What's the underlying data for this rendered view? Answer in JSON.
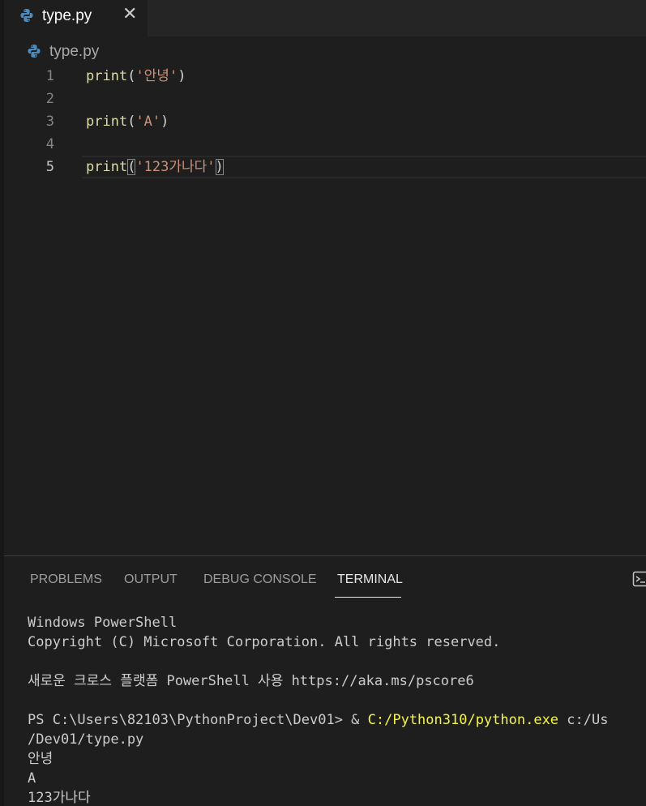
{
  "tab": {
    "label": "type.py",
    "close": "✕"
  },
  "breadcrumb": {
    "file": "type.py"
  },
  "editor": {
    "lines": [
      {
        "num": "1",
        "fn": "print",
        "open": "(",
        "str": "'안녕'",
        "close": ")"
      },
      {
        "num": "2"
      },
      {
        "num": "3",
        "fn": "print",
        "open": "(",
        "str": "'A'",
        "close": ")"
      },
      {
        "num": "4"
      },
      {
        "num": "5",
        "fn": "print",
        "open": "(",
        "str": "'123가나다'",
        "close": ")"
      }
    ]
  },
  "panel": {
    "tabs": [
      "PROBLEMS",
      "OUTPUT",
      "DEBUG CONSOLE",
      "TERMINAL"
    ],
    "active_tab": "TERMINAL"
  },
  "terminal": {
    "line1": "Windows PowerShell",
    "line2": "Copyright (C) Microsoft Corporation. All rights reserved.",
    "line3": "새로운 크로스 플랫폼 PowerShell 사용 https://aka.ms/pscore6",
    "prompt": "PS C:\\Users\\82103\\PythonProject\\Dev01> & ",
    "exe": "C:/Python310/python.exe",
    "args": " c:/Us",
    "line5": "/Dev01/type.py",
    "out1": "안녕",
    "out2": "A",
    "out3": "123가나다"
  },
  "colors": {
    "python_icon": "#4b8bbe",
    "accent_yellow": "#f5f543"
  }
}
